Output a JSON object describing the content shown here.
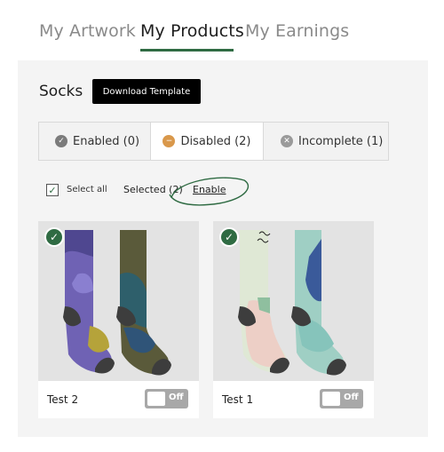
{
  "top_tabs": [
    {
      "label": "My Artwork"
    },
    {
      "label": "My Products"
    },
    {
      "label": "My Earnings"
    }
  ],
  "section": {
    "title": "Socks",
    "download_label": "Download Template"
  },
  "filters": [
    {
      "label": "Enabled (0)",
      "icon": "check-circle-icon",
      "color": "#7b7b7b"
    },
    {
      "label": "Disabled (2)",
      "icon": "minus-circle-icon",
      "color": "#d9984b"
    },
    {
      "label": "Incomplete (1)",
      "icon": "x-circle-icon",
      "color": "#9a9a9a"
    }
  ],
  "selection": {
    "select_all_label": "Select all",
    "selected_label": "Selected (2)",
    "action_label": "Enable"
  },
  "products": [
    {
      "name": "Test 2",
      "toggle_label": "Off",
      "selected": true
    },
    {
      "name": "Test 1",
      "toggle_label": "Off",
      "selected": true
    }
  ],
  "colors": {
    "accent": "#2f6b43",
    "toggle_off": "#a8a8a8"
  }
}
